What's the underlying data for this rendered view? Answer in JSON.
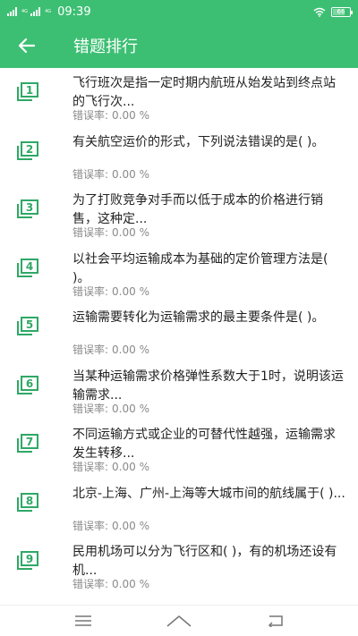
{
  "status_bar": {
    "network_1": "4G",
    "network_2": "4G",
    "time": "09:39",
    "battery": "66"
  },
  "header": {
    "title": "错题排行"
  },
  "questions": [
    {
      "num": "1",
      "text": "飞行班次是指一定时期内航班从始发站到终点站的飞行次...",
      "error_label": "错误率:",
      "error_value": "0.00 %"
    },
    {
      "num": "2",
      "text": "有关航空运价的形式，下列说法错误的是(  )。",
      "error_label": "错误率:",
      "error_value": "0.00 %"
    },
    {
      "num": "3",
      "text": "为了打败竞争对手而以低于成本的价格进行销售，这种定...",
      "error_label": "错误率:",
      "error_value": "0.00 %"
    },
    {
      "num": "4",
      "text": "以社会平均运输成本为基础的定价管理方法是(  )。",
      "error_label": "错误率:",
      "error_value": "0.00 %"
    },
    {
      "num": "5",
      "text": "运输需要转化为运输需求的最主要条件是(  )。",
      "error_label": "错误率:",
      "error_value": "0.00 %"
    },
    {
      "num": "6",
      "text": "当某种运输需求价格弹性系数大于1时，说明该运输需求...",
      "error_label": "错误率:",
      "error_value": "0.00 %"
    },
    {
      "num": "7",
      "text": "不同运输方式或企业的可替代性越强，运输需求发生转移...",
      "error_label": "错误率:",
      "error_value": "0.00 %"
    },
    {
      "num": "8",
      "text": "北京-上海、广州-上海等大城市间的航线属于(  )...",
      "error_label": "错误率:",
      "error_value": "0.00 %"
    },
    {
      "num": "9",
      "text": "民用机场可以分为飞行区和(  )，有的机场还设有机...",
      "error_label": "错误率:",
      "error_value": "0.00 %"
    }
  ],
  "colors": {
    "primary": "#3dbf73",
    "icon": "#2fa866",
    "text": "#222222",
    "muted": "#8a8a8a"
  },
  "icons": {
    "back": "arrow-left-icon",
    "item": "numbered-stack-icon",
    "nav_menu": "menu-icon",
    "nav_home": "home-icon",
    "nav_back": "back-icon"
  }
}
